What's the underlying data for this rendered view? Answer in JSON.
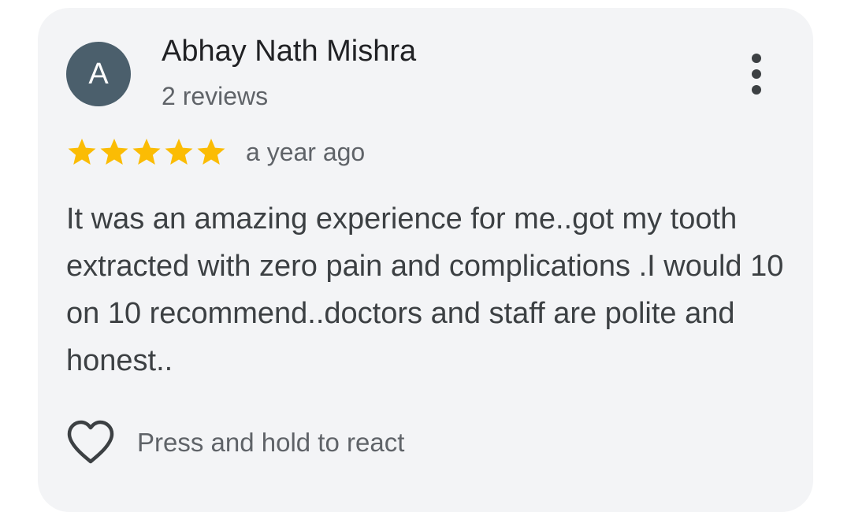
{
  "review": {
    "author": {
      "initial": "A",
      "name": "Abhay Nath Mishra",
      "review_count": "2 reviews",
      "avatar_color": "#4b5f6c"
    },
    "rating": 5,
    "rating_max": 5,
    "star_color": "#fbbc04",
    "time_ago": "a year ago",
    "text": "It was an amazing experience for me..got my tooth extracted with zero pain and complications .I would 10 on 10 recommend..doctors and staff are polite and honest..",
    "react_label": "Press and hold to react",
    "icons": {
      "more": "more-vertical-icon",
      "react": "heart-outline-icon",
      "star": "star-icon"
    }
  }
}
